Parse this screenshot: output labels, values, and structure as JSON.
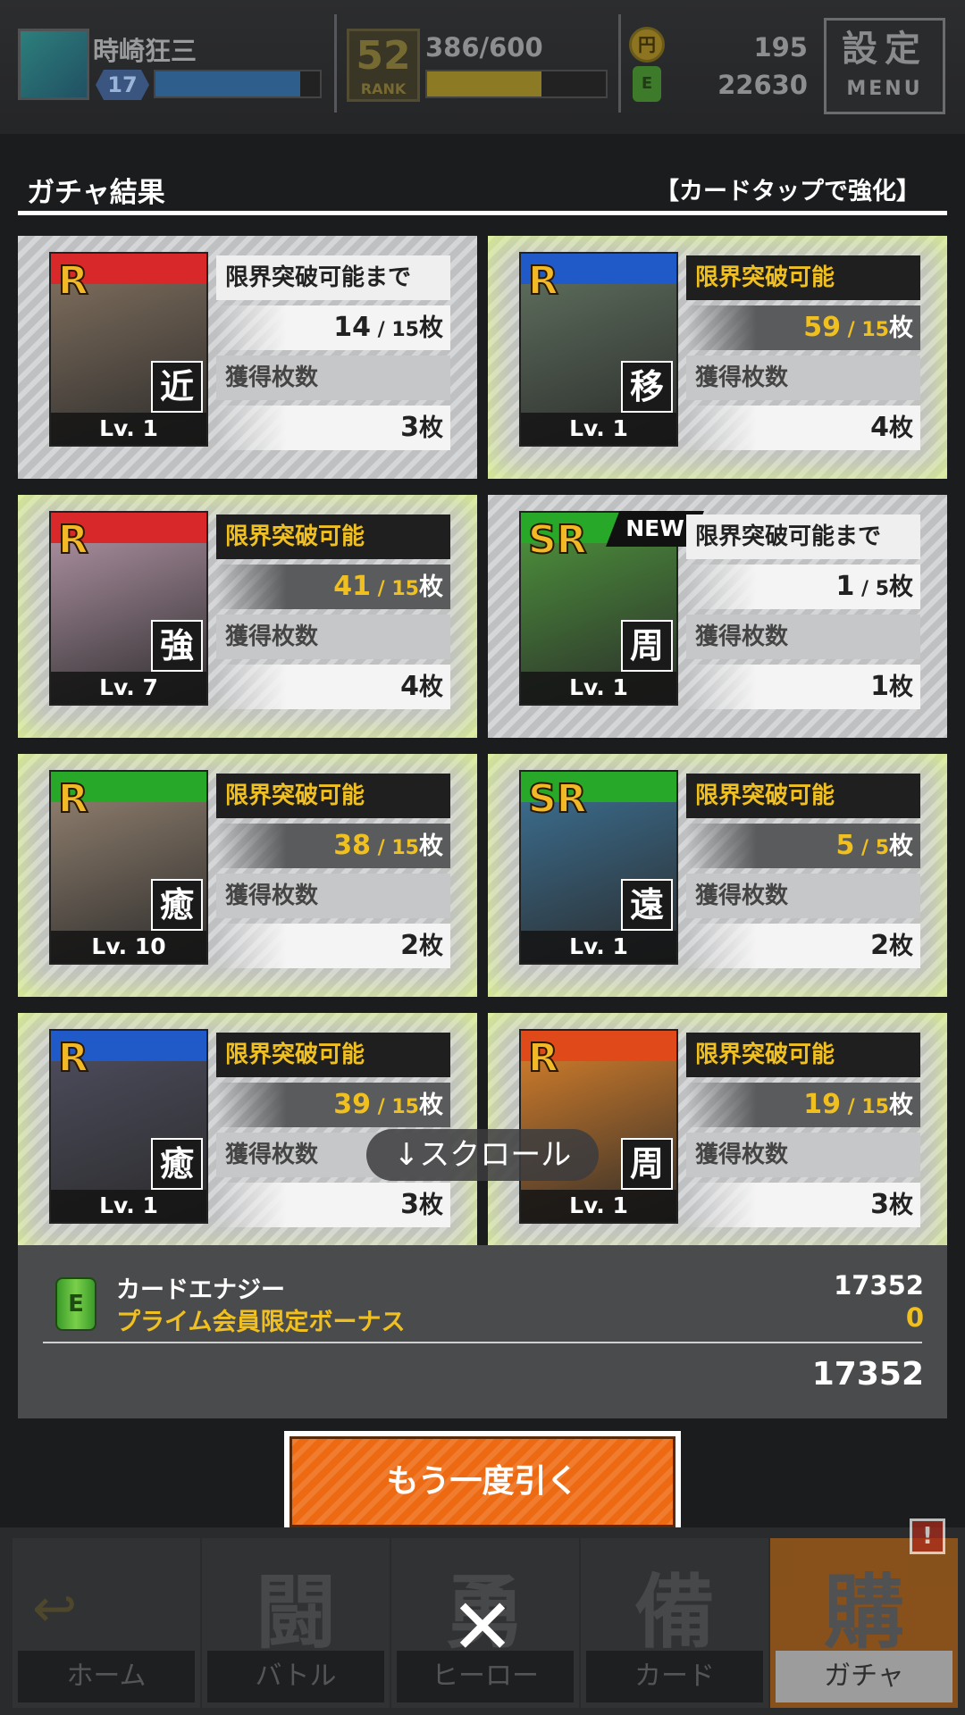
{
  "header": {
    "player_name": "時崎狂三",
    "player_level": "17",
    "xp_progress": 0.88,
    "rank": "52",
    "rank_label": "RANK",
    "stamina": "386/600",
    "stamina_progress": 0.64,
    "coins": "195",
    "coin_icon": "円",
    "energy": "22630",
    "menu_kanji": "設定",
    "menu_label": "MENU"
  },
  "panel": {
    "title": "ガチャ結果",
    "hint": "【カードタップで強化】"
  },
  "cards": [
    {
      "rarity": "R",
      "role": "近",
      "level": "Lv. 1",
      "status": "限界突破可能まで",
      "status_highlight": false,
      "count": "14",
      "max": "15",
      "unit": "枚",
      "obtained_label": "獲得枚数",
      "obtained": "3",
      "glow": false,
      "new": false,
      "band_color": "#d8282a",
      "art_color": "#7a6a5a"
    },
    {
      "rarity": "R",
      "role": "移",
      "level": "Lv. 1",
      "status": "限界突破可能",
      "status_highlight": true,
      "count": "59",
      "max": "15",
      "unit": "枚",
      "obtained_label": "獲得枚数",
      "obtained": "4",
      "glow": true,
      "new": false,
      "band_color": "#1f5ac8",
      "art_color": "#5a6a5a"
    },
    {
      "rarity": "R",
      "role": "強",
      "level": "Lv. 7",
      "status": "限界突破可能",
      "status_highlight": true,
      "count": "41",
      "max": "15",
      "unit": "枚",
      "obtained_label": "獲得枚数",
      "obtained": "4",
      "glow": true,
      "new": false,
      "band_color": "#d8282a",
      "art_color": "#a58a9a"
    },
    {
      "rarity": "SR",
      "role": "周",
      "level": "Lv. 1",
      "status": "限界突破可能まで",
      "status_highlight": false,
      "count": "1",
      "max": "5",
      "unit": "枚",
      "obtained_label": "獲得枚数",
      "obtained": "1",
      "glow": false,
      "new": true,
      "new_label": "NEW",
      "band_color": "#28a828",
      "art_color": "#4a8a3a"
    },
    {
      "rarity": "R",
      "role": "癒",
      "level": "Lv. 10",
      "status": "限界突破可能",
      "status_highlight": true,
      "count": "38",
      "max": "15",
      "unit": "枚",
      "obtained_label": "獲得枚数",
      "obtained": "2",
      "glow": true,
      "new": false,
      "band_color": "#28a828",
      "art_color": "#8a7a6a"
    },
    {
      "rarity": "SR",
      "role": "遠",
      "level": "Lv. 1",
      "status": "限界突破可能",
      "status_highlight": true,
      "count": "5",
      "max": "5",
      "unit": "枚",
      "obtained_label": "獲得枚数",
      "obtained": "2",
      "glow": true,
      "new": false,
      "band_color": "#28a828",
      "art_color": "#3a6a8a"
    },
    {
      "rarity": "R",
      "role": "癒",
      "level": "Lv. 1",
      "status": "限界突破可能",
      "status_highlight": true,
      "count": "39",
      "max": "15",
      "unit": "枚",
      "obtained_label": "獲得枚数",
      "obtained": "3",
      "glow": true,
      "new": false,
      "band_color": "#1f5ac8",
      "art_color": "#4a4a5a"
    },
    {
      "rarity": "R",
      "role": "周",
      "level": "Lv. 1",
      "status": "限界突破可能",
      "status_highlight": true,
      "count": "19",
      "max": "15",
      "unit": "枚",
      "obtained_label": "獲得枚数",
      "obtained": "3",
      "glow": true,
      "new": false,
      "band_color": "#e04a1a",
      "art_color": "#c8782a"
    }
  ],
  "scroll_hint": "↓スクロール",
  "energy_summary": {
    "icon": "E",
    "label": "カードエナジー",
    "value": "17352",
    "prime_label": "プライム会員限定ボーナス",
    "prime_value": "0",
    "total": "17352"
  },
  "redraw_button": "もう一度引く",
  "bottom_nav": [
    {
      "kanji": "",
      "icon": "↩",
      "label": "ホーム",
      "active": false
    },
    {
      "kanji": "闘",
      "icon": "",
      "label": "バトル",
      "active": false
    },
    {
      "kanji": "勇",
      "icon": "",
      "label": "ヒーロー",
      "active": false
    },
    {
      "kanji": "備",
      "icon": "",
      "label": "カード",
      "active": false
    },
    {
      "kanji": "購",
      "icon": "",
      "label": "ガチャ",
      "active": true
    }
  ],
  "alert_badge": "!",
  "close_icon": "✕"
}
